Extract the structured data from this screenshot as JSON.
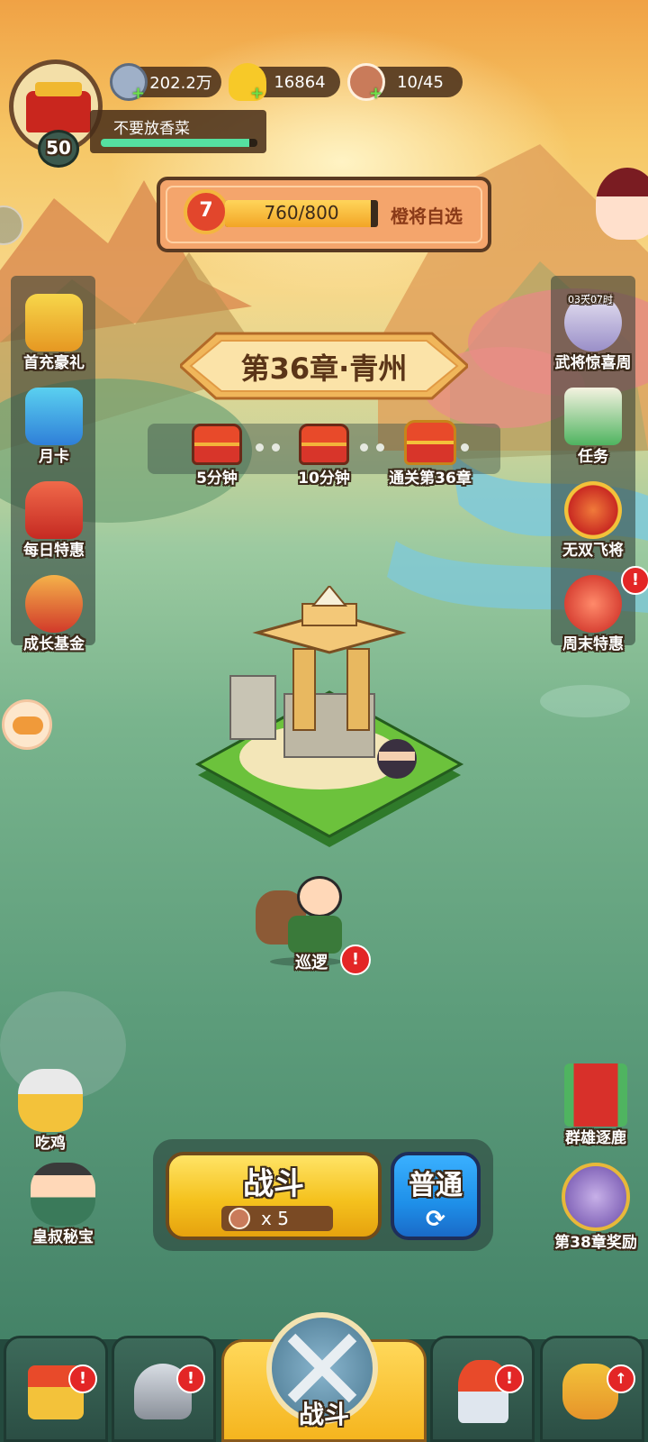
{
  "player": {
    "name": "不要放香菜",
    "level": "50",
    "exp_fraction": 0.95
  },
  "resources": {
    "silver": "202.2万",
    "gold": "16864",
    "stamina": "10/45"
  },
  "rank_bar": {
    "rank": "7",
    "progress_text": "760/800",
    "progress_fraction": 0.95,
    "reward_label": "橙将自选"
  },
  "chapter": {
    "title": "第36章·青州",
    "chests": [
      {
        "label": "5分钟"
      },
      {
        "label": "10分钟"
      },
      {
        "label": "通关第36章"
      }
    ]
  },
  "left_menu": [
    {
      "label": "首充豪礼",
      "icon": "crown-chest-icon"
    },
    {
      "label": "月卡",
      "icon": "month-card-icon"
    },
    {
      "label": "每日特惠",
      "icon": "gift-bag-icon"
    },
    {
      "label": "成长基金",
      "icon": "fortune-god-icon"
    }
  ],
  "right_menu": [
    {
      "label": "武将惊喜周",
      "icon": "sage-portrait-icon",
      "timer": "03天07时"
    },
    {
      "label": "任务",
      "icon": "scroll-icon"
    },
    {
      "label": "无双飞将",
      "icon": "emblem-icon"
    },
    {
      "label": "周末特惠",
      "icon": "red-orb-icon",
      "badge": "!"
    }
  ],
  "map": {
    "patrol_label": "巡逻",
    "patrol_badge": "!"
  },
  "bottom_left": [
    {
      "label": "吃鸡",
      "icon": "sunglasses-hero-icon"
    },
    {
      "label": "皇叔秘宝",
      "icon": "sleeping-lord-icon"
    }
  ],
  "bottom_right": [
    {
      "label": "群雄逐鹿",
      "icon": "war-banner-icon"
    },
    {
      "label": "第38章奖励",
      "icon": "heroine-portrait-icon"
    }
  ],
  "battle": {
    "label": "战斗",
    "cost": "x 5",
    "mode_label": "普通"
  },
  "nav": [
    {
      "name": "city",
      "icon": "gate-coin-icon",
      "badge": "!"
    },
    {
      "name": "hero",
      "icon": "helmet-icon",
      "badge": "!"
    },
    {
      "name": "battle",
      "icon": "crossed-swords-icon",
      "label": "战斗"
    },
    {
      "name": "equip",
      "icon": "sword-stars-icon",
      "badge": "!"
    },
    {
      "name": "power",
      "icon": "fist-upgrade-icon",
      "badge": "↑"
    }
  ],
  "colors": {
    "accent_yellow": "#f7c928",
    "battle_blue": "#1e8fe8",
    "badge_red": "#e32626"
  }
}
